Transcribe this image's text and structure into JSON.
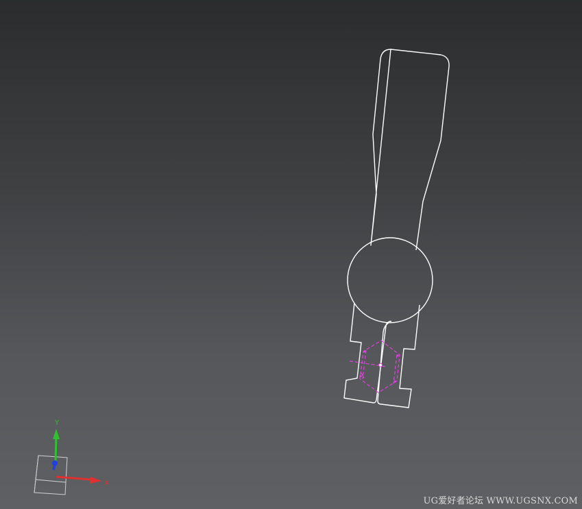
{
  "viewport": {
    "background_top": "#2b2c2e",
    "background_bottom": "#5e6063"
  },
  "part": {
    "outline_color": "#ffffff",
    "sketch_color": "#e040e0"
  },
  "triad": {
    "x_label": "X",
    "y_label": "Y",
    "x_color": "#e03030",
    "y_color": "#30c030",
    "z_color": "#2040e0"
  },
  "watermark": {
    "text": "UG爱好者论坛 WWW.UGSNX.COM"
  }
}
